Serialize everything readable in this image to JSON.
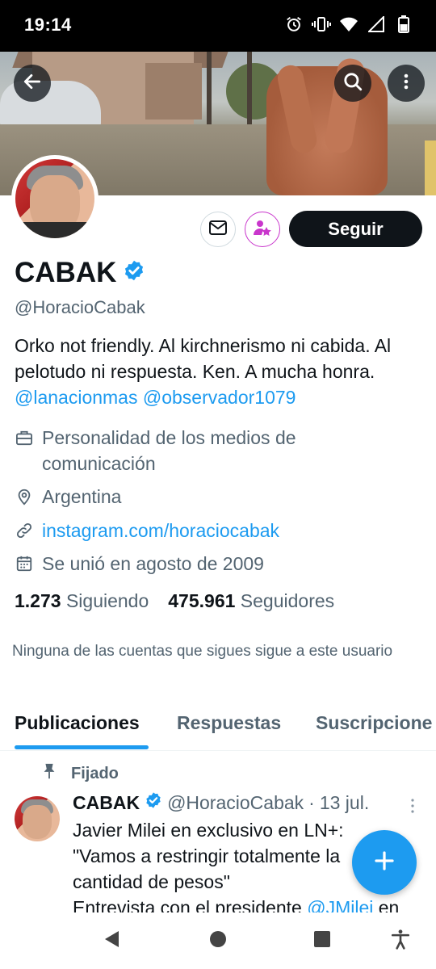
{
  "status_bar": {
    "time": "19:14",
    "icons": [
      "alarm-icon",
      "vibrate-icon",
      "wifi-icon",
      "signal-icon",
      "battery-icon"
    ]
  },
  "header": {
    "back_icon": "arrow-left-icon",
    "search_icon": "search-icon",
    "more_icon": "more-vertical-icon"
  },
  "profile": {
    "display_name": "CABAK",
    "verified": true,
    "handle": "@HoracioCabak",
    "bio_text": "Orko not friendly. Al kirchnerismo ni cabida. Al pelotudo ni respuesta. Ken. A mucha honra.",
    "bio_links": [
      "@lanacionmas",
      "@observador1079"
    ],
    "category": "Personalidad de los medios de comunicación",
    "location": "Argentina",
    "website": "instagram.com/horaciocabak",
    "joined": "Se unió en agosto de 2009",
    "following_count": "1.273",
    "following_label": "Siguiendo",
    "followers_count": "475.961",
    "followers_label": "Seguidores",
    "mutuals_notice": "Ninguna de las cuentas que sigues sigue a este usuario"
  },
  "actions": {
    "message_icon": "envelope-icon",
    "subscribe_icon": "subscribe-star-icon",
    "follow_label": "Seguir"
  },
  "tabs": [
    {
      "label": "Publicaciones",
      "active": true
    },
    {
      "label": "Respuestas",
      "active": false
    },
    {
      "label": "Suscripcione",
      "active": false
    }
  ],
  "post": {
    "pinned_label": "Fijado",
    "author_name": "CABAK",
    "author_handle": "@HoracioCabak",
    "separator": "·",
    "date": "13 jul.",
    "text_line1": "Javier Milei en exclusivo en LN+:",
    "text_line2": "\"Vamos a restringir totalmente la",
    "text_line3": "cantidad de pesos\"",
    "text_line4_prefix": "Entrevista con el presidente ",
    "text_line4_link": "@JMilei",
    "text_line4_suffix": " en"
  },
  "colors": {
    "accent": "#1d9bf0",
    "text_primary": "#0f1419",
    "text_secondary": "#536471",
    "subscribe": "#c936cc"
  }
}
